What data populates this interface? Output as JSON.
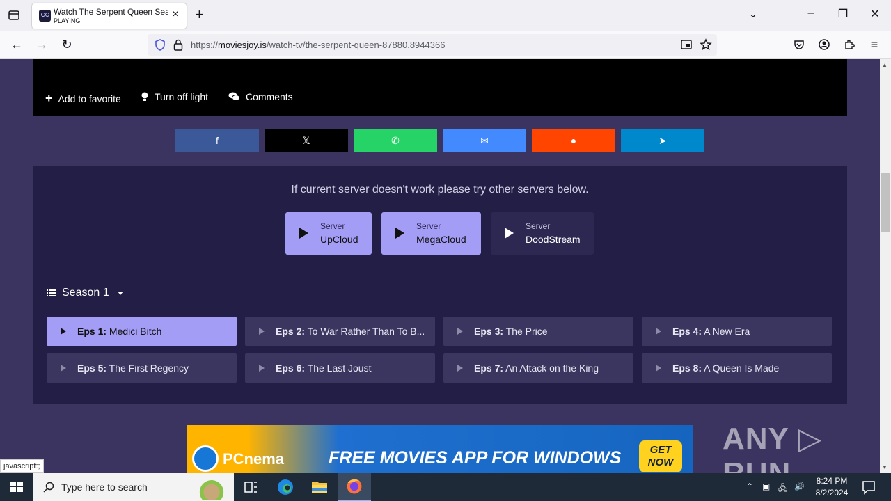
{
  "browser": {
    "tab_title": "Watch The Serpent Queen Season",
    "tab_status": "PLAYING",
    "url_prefix": "https://",
    "url_domain": "moviesjoy.is",
    "url_path": "/watch-tv/the-serpent-queen-87880.8944366"
  },
  "player_bar": {
    "favorite": "Add to favorite",
    "light": "Turn off light",
    "comments": "Comments"
  },
  "share": [
    {
      "name": "facebook",
      "glyph": "f",
      "color": "#3b5998"
    },
    {
      "name": "x",
      "glyph": "𝕏",
      "color": "#000000"
    },
    {
      "name": "whatsapp",
      "glyph": "✆",
      "color": "#25d366"
    },
    {
      "name": "messenger",
      "glyph": "✉",
      "color": "#448aff"
    },
    {
      "name": "reddit",
      "glyph": "●",
      "color": "#ff4500"
    },
    {
      "name": "telegram",
      "glyph": "➤",
      "color": "#0088cc"
    }
  ],
  "servers": {
    "note": "If current server doesn't work please try other servers below.",
    "label": "Server",
    "list": [
      {
        "name": "UpCloud",
        "active": true
      },
      {
        "name": "MegaCloud",
        "active": true
      },
      {
        "name": "DoodStream",
        "active": false
      }
    ]
  },
  "season": {
    "label": "Season 1"
  },
  "episodes": [
    {
      "num": "Eps 1:",
      "title": "Medici Bitch",
      "active": true
    },
    {
      "num": "Eps 2:",
      "title": "To War Rather Than To B...",
      "active": false
    },
    {
      "num": "Eps 3:",
      "title": "The Price",
      "active": false
    },
    {
      "num": "Eps 4:",
      "title": "A New Era",
      "active": false
    },
    {
      "num": "Eps 5:",
      "title": "The First Regency",
      "active": false
    },
    {
      "num": "Eps 6:",
      "title": "The Last Joust",
      "active": false
    },
    {
      "num": "Eps 7:",
      "title": "An Attack on the King",
      "active": false
    },
    {
      "num": "Eps 8:",
      "title": "A Queen Is Made",
      "active": false
    }
  ],
  "ad": {
    "brand": "PCnema",
    "headline": "FREE MOVIES APP FOR WINDOWS",
    "cta_line1": "GET",
    "cta_line2": "NOW"
  },
  "watermark": "ANY ▷ RUN",
  "status_link": "javascript:;",
  "taskbar": {
    "search_placeholder": "Type here to search",
    "time": "8:24 PM",
    "date": "8/2/2024"
  }
}
